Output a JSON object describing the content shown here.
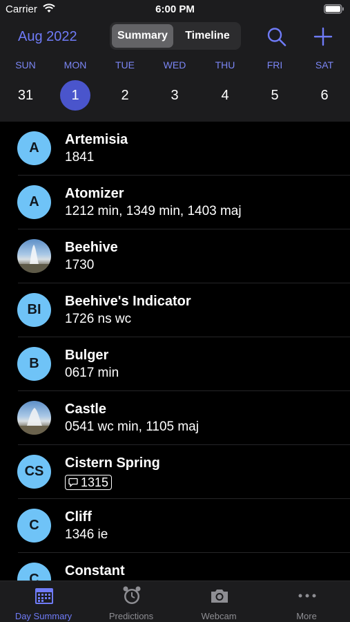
{
  "status_bar": {
    "carrier": "Carrier",
    "time": "6:00 PM"
  },
  "header": {
    "month": "Aug 2022",
    "segments": [
      "Summary",
      "Timeline"
    ],
    "selected_segment": "Summary",
    "search_icon": "magnifying-glass-icon",
    "add_icon": "plus-icon",
    "accent_color": "#6f7bf7"
  },
  "week": {
    "days": [
      "SUN",
      "MON",
      "TUE",
      "WED",
      "THU",
      "FRI",
      "SAT"
    ],
    "dates": [
      "31",
      "1",
      "2",
      "3",
      "4",
      "5",
      "6"
    ],
    "selected_date": "1",
    "selected_color": "#4a55cc"
  },
  "geysers": [
    {
      "name": "Artemisia",
      "detail": "1841",
      "avatar": "A"
    },
    {
      "name": "Atomizer",
      "detail": "1212 min, 1349 min, 1403 maj",
      "avatar": "A"
    },
    {
      "name": "Beehive",
      "detail": "1730",
      "avatar": "photo"
    },
    {
      "name": "Beehive's Indicator",
      "detail": "1726 ns wc",
      "avatar": "BI"
    },
    {
      "name": "Bulger",
      "detail": "0617 min",
      "avatar": "B"
    },
    {
      "name": "Castle",
      "detail": "0541 wc min, 1105 maj",
      "avatar": "photo"
    },
    {
      "name": "Cistern Spring",
      "detail": "1315",
      "avatar": "CS",
      "detail_has_comment_icon": true
    },
    {
      "name": "Cliff",
      "detail": "1346 ie",
      "avatar": "C"
    },
    {
      "name": "Constant",
      "detail": "",
      "avatar": "C"
    }
  ],
  "tabs": [
    {
      "label": "Day Summary",
      "icon": "calendar-grid-icon",
      "active": true
    },
    {
      "label": "Predictions",
      "icon": "alarm-clock-icon",
      "active": false
    },
    {
      "label": "Webcam",
      "icon": "camera-icon",
      "active": false
    },
    {
      "label": "More",
      "icon": "ellipsis-icon",
      "active": false
    }
  ]
}
